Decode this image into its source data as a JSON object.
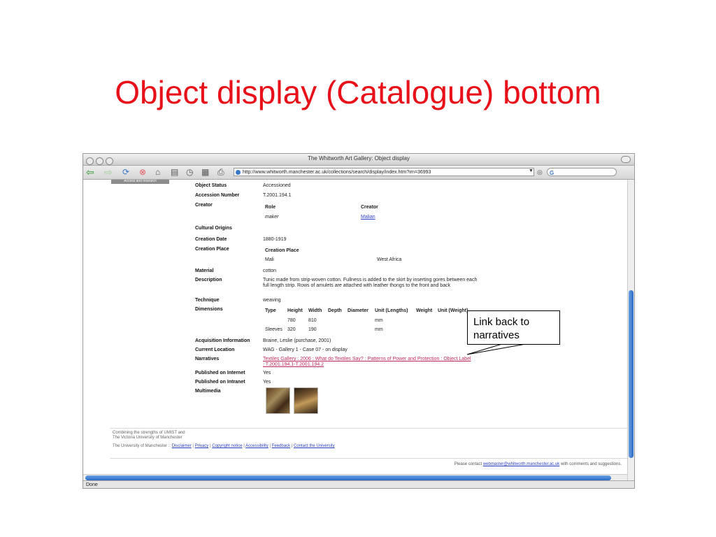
{
  "slide": {
    "title": "Object display (Catalogue) bottom"
  },
  "browser": {
    "window_title": "The Whitworth Art Gallery: Object display",
    "url": "http://www.whitworth.manchester.ac.uk/collections/search/display/index.htm?irn=36993",
    "search_icon_letter": "G",
    "status": "Done"
  },
  "page": {
    "sidebar_button": "Access and research",
    "fields": {
      "object_status": {
        "label": "Object Status",
        "value": "Accessioned"
      },
      "accession_number": {
        "label": "Accession Number",
        "value": "T.2001.194.1"
      },
      "creator": {
        "label": "Creator",
        "role_header": "Role",
        "creator_header": "Creator",
        "role": "maker",
        "name": "Malian"
      },
      "cultural_origins": {
        "label": "Cultural Origins"
      },
      "creation_date": {
        "label": "Creation Date",
        "value": "1880-1919"
      },
      "creation_place": {
        "label": "Creation Place",
        "header": "Creation Place",
        "place": "Mali",
        "region": "West Africa"
      },
      "material": {
        "label": "Material",
        "value": "cotton"
      },
      "description": {
        "label": "Description",
        "value": "Tunic made from strip-woven cotton. Fullness is added to the skirt by inserting gores between each full length strip. Rows of amulets are attached with leather thongs to the front and back"
      },
      "technique": {
        "label": "Technique",
        "value": "weaving"
      },
      "dimensions": {
        "label": "Dimensions",
        "headers": [
          "Type",
          "Height",
          "Width",
          "Depth",
          "Diameter",
          "Unit (Lengths)",
          "Weight",
          "Unit (Weight)"
        ],
        "rows": [
          {
            "type": "",
            "height": "780",
            "width": "810",
            "unit": "mm"
          },
          {
            "type": "Sleeves",
            "height": "320",
            "width": "190",
            "unit": "mm"
          }
        ]
      },
      "acquisition": {
        "label": "Acquisition Information",
        "value": "Braine, Leslie (purchase, 2001)"
      },
      "current_location": {
        "label": "Current Location",
        "value": "WAG - Gallery 1 - Case 07 - on display"
      },
      "narratives": {
        "label": "Narratives",
        "value": "Textiles Gallery : 2006 : What do Textiles Say? : Patterns of Power and Protection : Object Label : T.2001.194.1-T.2001.194.2"
      },
      "published_internet": {
        "label": "Published on Internet",
        "value": "Yes"
      },
      "published_intranet": {
        "label": "Published on Intranet",
        "value": "Yes"
      },
      "multimedia": {
        "label": "Multimedia"
      }
    },
    "footer": {
      "line1": "Combining the strengths of UMIST and",
      "line2": "The Victoria University of Manchester",
      "university": "The University of Manchester ::",
      "links": [
        "Disclaimer",
        "Privacy",
        "Copyright notice",
        "Accessibility",
        "Feedback",
        "Contact the University"
      ],
      "contact_prefix": "Please contact",
      "contact_email": "webmaster@whitworth.manchester.ac.uk",
      "contact_suffix": "with comments and suggestions."
    }
  },
  "callout": {
    "text": "Link back to narratives"
  }
}
